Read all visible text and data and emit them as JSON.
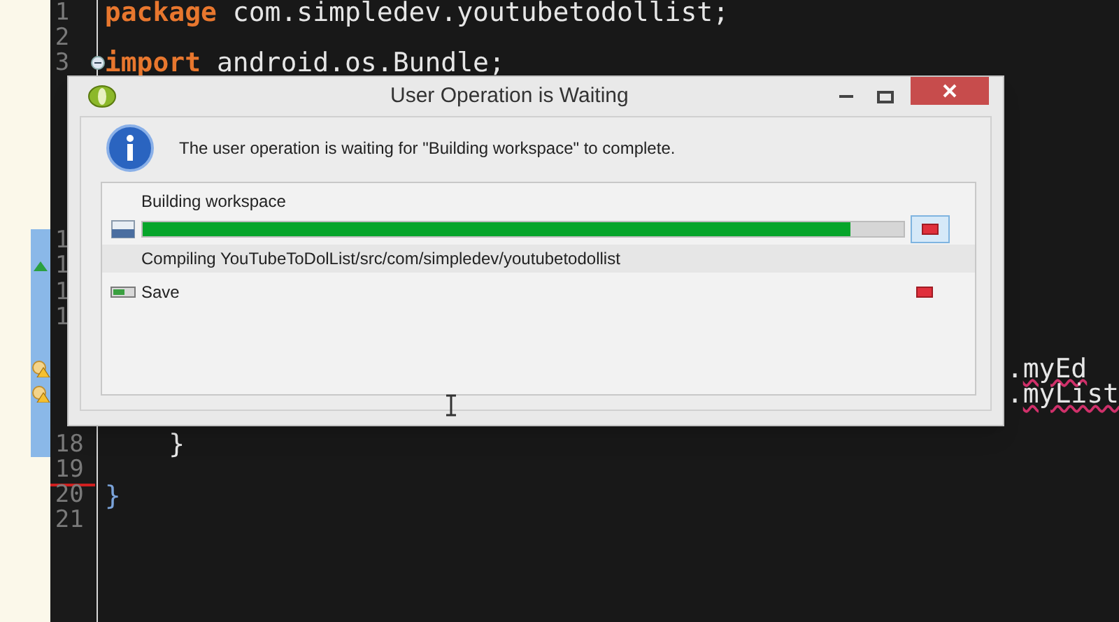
{
  "editor": {
    "lines": [
      {
        "number": "1",
        "highlighted": false,
        "code": [
          {
            "kind": "keyword",
            "text": "package"
          },
          {
            "kind": "plain",
            "text": " com.simpledev.youtubetodollist;"
          }
        ]
      },
      {
        "number": "2",
        "highlighted": false
      },
      {
        "number": "3",
        "highlighted": false,
        "fold": true,
        "code": [
          {
            "kind": "keyword",
            "text": "import"
          },
          {
            "kind": "plain",
            "text": " android.os.Bundle;"
          }
        ]
      },
      {
        "highlighted": false
      },
      {
        "highlighted": false
      },
      {
        "highlighted": false
      },
      {
        "highlighted": false
      },
      {
        "highlighted": false
      },
      {
        "highlighted": false
      },
      {
        "number": "1",
        "highlighted": true
      },
      {
        "number": "1",
        "highlighted": true,
        "override": true
      },
      {
        "number": "1",
        "highlighted": true
      },
      {
        "number": "1",
        "highlighted": true
      },
      {
        "highlighted": true
      },
      {
        "highlighted": true,
        "warning": true,
        "kind": "tail",
        "code": [
          {
            "kind": "plain",
            "text": "."
          },
          {
            "kind": "error",
            "text": "myEd"
          }
        ]
      },
      {
        "highlighted": true,
        "warning": true,
        "kind": "tail",
        "code": [
          {
            "kind": "plain",
            "text": "."
          },
          {
            "kind": "error",
            "text": "myList"
          }
        ]
      },
      {
        "highlighted": true
      },
      {
        "number": "18",
        "highlighted": true,
        "kind": "full",
        "code": [
          {
            "kind": "plain",
            "text": "    }"
          }
        ]
      },
      {
        "number": "19",
        "highlighted": false,
        "error": true
      },
      {
        "number": "20",
        "highlighted": false,
        "kind": "full",
        "code": [
          {
            "kind": "brace",
            "text": "}"
          }
        ]
      },
      {
        "number": "21",
        "highlighted": false
      }
    ]
  },
  "dialog": {
    "title": "User Operation is Waiting",
    "message": "The user operation is waiting for \"Building workspace\" to complete.",
    "jobs": [
      {
        "kind": "progress",
        "name": "Building workspace",
        "level": 0.93,
        "detail": "Compiling YouTubeToDolList/src/com/simpledev/youtubetodollist",
        "hovered": true
      },
      {
        "kind": "plain",
        "name": "Save",
        "hovered": false
      }
    ]
  }
}
